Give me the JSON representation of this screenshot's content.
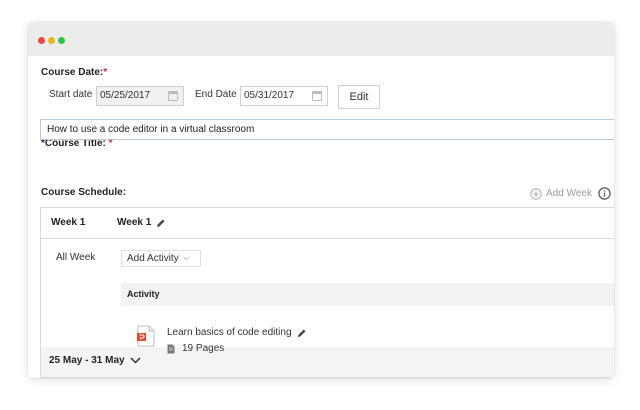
{
  "course_date": {
    "label": "Course Date:",
    "required_mark": "*"
  },
  "start_date": {
    "label": "Start date",
    "value": "05/25/2017"
  },
  "end_date": {
    "label": "End Date",
    "value": "05/31/2017"
  },
  "edit_button": {
    "label": "Edit"
  },
  "course_title": {
    "label": "*Course Title:",
    "required_mark": "*",
    "value": "How to use a code editor in a virtual classroom"
  },
  "schedule": {
    "label": "Course Schedule:",
    "add_week_label": "Add Week",
    "week_col": "Week 1",
    "week_name": "Week 1",
    "row_label": "All Week",
    "add_activity_label": "Add Activity",
    "activity_header": "Activity",
    "activity_title": "Learn basics of code editing",
    "activity_pages": "19 Pages",
    "range_label": "25 May - 31 May"
  },
  "colors": {
    "accent_border": "#b9cde0",
    "required": "#d62b2b"
  },
  "icons": [
    "calendar-icon",
    "pencil-icon",
    "plus-circle-icon",
    "info-icon",
    "chevron-down-icon",
    "file-icon",
    "document-icon"
  ]
}
